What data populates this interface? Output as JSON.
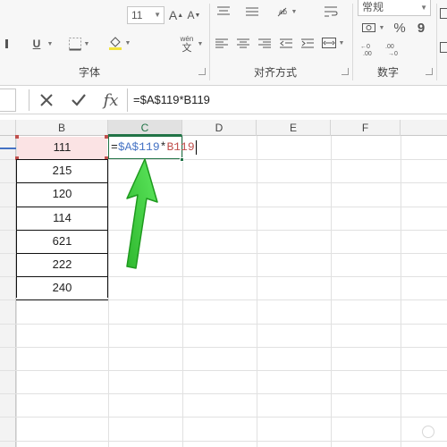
{
  "ribbon": {
    "font_size": "11",
    "number_format": "常规",
    "phonetic_label": "wén",
    "phonetic_char": "文",
    "groups": {
      "font": "字体",
      "alignment": "对齐方式",
      "number": "数字"
    },
    "icons": [
      "font-grow-icon",
      "font-shrink-icon",
      "underline-icon",
      "border-icon",
      "fill-color-icon",
      "phonetic-icon",
      "wrap-text-icon",
      "merge-center-icon",
      "percent-icon",
      "comma-icon",
      "increase-decimal-icon",
      "decrease-decimal-icon",
      "accounting-format-icon"
    ]
  },
  "ribbon_labels": {
    "underline": "U",
    "percent": "%",
    "comma": "9",
    "font_A": "A"
  },
  "formula_bar": {
    "formula": "=$A$119*B119",
    "fx_label": "fx"
  },
  "grid": {
    "columns": [
      "B",
      "C",
      "D",
      "E",
      "F"
    ],
    "active_column": "C",
    "column_b_values": [
      "111",
      "215",
      "120",
      "114",
      "621",
      "222",
      "240"
    ]
  },
  "cell_edit": {
    "eq": "=",
    "ref1": "$A$119",
    "op": "*",
    "ref2": "B119"
  },
  "colors": {
    "accent_green": "#217346",
    "ref1_color": "#4472c4",
    "ref2_color": "#c0504d",
    "highlight": "#fbe3e4",
    "arrow": "#3ad13a"
  },
  "watermark": {
    "line1": "",
    "line2": ""
  }
}
